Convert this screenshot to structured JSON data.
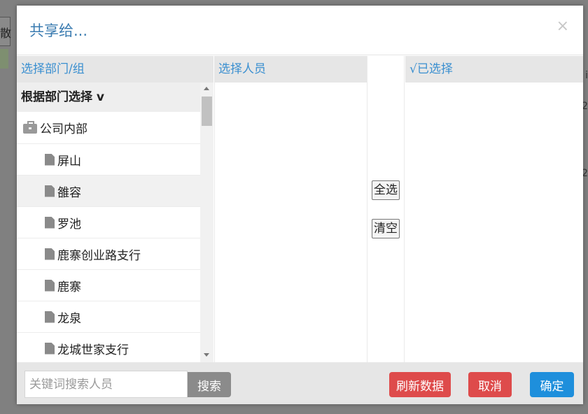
{
  "background": {
    "left_char": "散",
    "right_chars": [
      "i",
      "2",
      "2"
    ]
  },
  "dialog": {
    "title": "共享给...",
    "close_glyph": "×"
  },
  "columns": {
    "dept_header": "选择部门/组",
    "people_header": "选择人员",
    "selected_header": "√已选择"
  },
  "dept": {
    "title": "根据部门选择 v",
    "tree": [
      {
        "label": "公司内部",
        "icon": "briefcase-icon",
        "level": 0
      },
      {
        "label": "屏山",
        "icon": "document-icon",
        "level": 1
      },
      {
        "label": "雒容",
        "icon": "document-icon",
        "level": 1
      },
      {
        "label": "罗池",
        "icon": "document-icon",
        "level": 1
      },
      {
        "label": "鹿寨创业路支行",
        "icon": "document-icon",
        "level": 1
      },
      {
        "label": "鹿寨",
        "icon": "document-icon",
        "level": 1
      },
      {
        "label": "龙泉",
        "icon": "document-icon",
        "level": 1
      },
      {
        "label": "龙城世家支行",
        "icon": "document-icon",
        "level": 1
      }
    ]
  },
  "middle": {
    "select_all": "全选",
    "clear": "清空"
  },
  "footer": {
    "search_placeholder": "关键词搜索人员",
    "search_value": "",
    "search_button": "搜索",
    "refresh_button": "刷新数据",
    "cancel_button": "取消",
    "ok_button": "确定"
  },
  "colors": {
    "title": "#3a7bb0",
    "header_text": "#3a8fd0",
    "danger": "#de4b4b",
    "primary": "#1e8fdc",
    "neutral": "#8b8b8b"
  }
}
